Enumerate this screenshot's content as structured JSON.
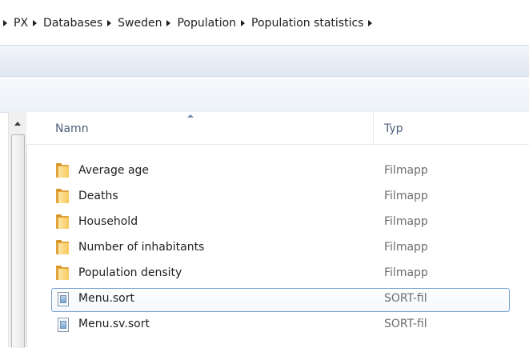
{
  "breadcrumb": {
    "items": [
      {
        "label": "PX"
      },
      {
        "label": "Databases"
      },
      {
        "label": "Sweden"
      },
      {
        "label": "Population"
      },
      {
        "label": "Population statistics"
      }
    ]
  },
  "columns": {
    "name": "Namn",
    "type": "Typ",
    "sorted_by": "name"
  },
  "files": [
    {
      "name": "Average age",
      "type": "Filmapp",
      "icon": "folder-icon",
      "selected": false
    },
    {
      "name": "Deaths",
      "type": "Filmapp",
      "icon": "folder-icon",
      "selected": false
    },
    {
      "name": "Household",
      "type": "Filmapp",
      "icon": "folder-icon",
      "selected": false
    },
    {
      "name": "Number of inhabitants",
      "type": "Filmapp",
      "icon": "folder-icon",
      "selected": false
    },
    {
      "name": "Population density",
      "type": "Filmapp",
      "icon": "folder-icon",
      "selected": false
    },
    {
      "name": "Menu.sort",
      "type": "SORT-fil",
      "icon": "file-icon",
      "selected": true
    },
    {
      "name": "Menu.sv.sort",
      "type": "SORT-fil",
      "icon": "file-icon",
      "selected": false
    }
  ]
}
